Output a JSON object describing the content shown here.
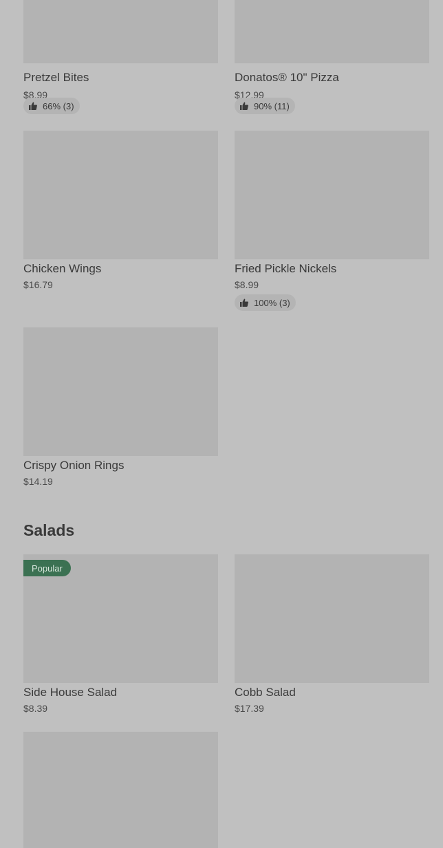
{
  "menu": {
    "items": [
      {
        "name": "Pretzel Bites",
        "price": "$8.99",
        "rating": "66% (3)"
      },
      {
        "name": "Donatos® 10\" Pizza",
        "price": "$12.99",
        "rating": "90% (11)"
      },
      {
        "name": "Chicken Wings",
        "price": "$16.79"
      },
      {
        "name": "Fried Pickle Nickels",
        "price": "$8.99",
        "rating": "100% (3)"
      },
      {
        "name": "Crispy Onion Rings",
        "price": "$14.19"
      }
    ]
  },
  "salads": {
    "title": "Salads",
    "items": [
      {
        "name": "Side House Salad",
        "price": "$8.39",
        "badge": "Popular"
      },
      {
        "name": "Cobb Salad",
        "price": "$17.39"
      }
    ]
  },
  "icons": {
    "rating": "thumbs-up-icon"
  },
  "colors": {
    "background": "#c0c0c0",
    "image_placeholder": "#b3b3b3",
    "badge": "#3b7152"
  }
}
